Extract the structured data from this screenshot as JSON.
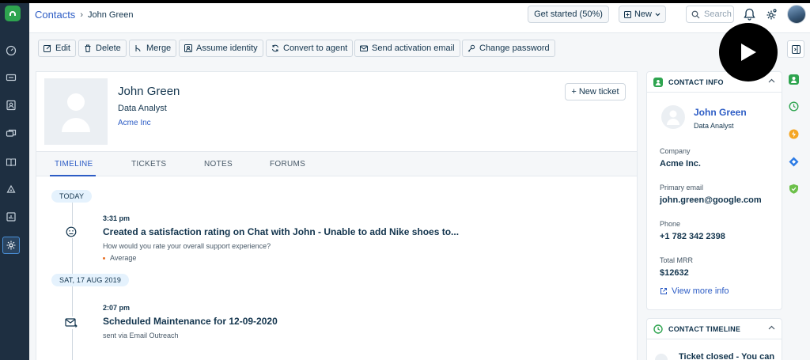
{
  "header": {
    "breadcrumb_root": "Contacts",
    "breadcrumb_sep": "›",
    "breadcrumb_current": "John Green",
    "get_started": "Get started (50%)",
    "new_label": "New",
    "search_placeholder": "Search"
  },
  "toolbar": {
    "edit": "Edit",
    "delete": "Delete",
    "merge": "Merge",
    "assume_identity": "Assume identity",
    "convert_to_agent": "Convert to agent",
    "send_activation_email": "Send activation email",
    "change_password": "Change password"
  },
  "contact": {
    "name": "John Green",
    "title": "Data Analyst",
    "company": "Acme Inc",
    "new_ticket": "New ticket",
    "new_ticket_plus": "+"
  },
  "tabs": [
    {
      "label": "TIMELINE",
      "active": true
    },
    {
      "label": "TICKETS",
      "active": false
    },
    {
      "label": "NOTES",
      "active": false
    },
    {
      "label": "FORUMS",
      "active": false
    }
  ],
  "timeline": {
    "groups": [
      {
        "day": "TODAY",
        "time": "3:31 pm",
        "title": "Created a satisfaction rating on Chat with John - Unable to add Nike shoes to...",
        "subtitle": "How would you rate your overall support experience?",
        "detail": "Average",
        "icon": "smiley-icon"
      },
      {
        "day": "SAT, 17 AUG 2019",
        "time": "2:07 pm",
        "title": "Scheduled Maintenance for 12-09-2020",
        "subtitle": "sent via Email Outreach",
        "icon": "email-out-icon"
      }
    ]
  },
  "contact_info": {
    "heading": "CONTACT INFO",
    "name": "John Green",
    "title": "Data Analyst",
    "company_label": "Company",
    "company_value": "Acme Inc.",
    "email_label": "Primary email",
    "email_value": "john.green@google.com",
    "phone_label": "Phone",
    "phone_value": "+1 782 342 2398",
    "mrr_label": "Total MRR",
    "mrr_value": "$12632",
    "view_more": "View more info"
  },
  "contact_timeline": {
    "heading": "CONTACT TIMELINE",
    "first_item": "Ticket closed - You can"
  },
  "colors": {
    "nav_bg": "#1e2f41",
    "link": "#2c5cc5",
    "brand_green": "#2ea44f",
    "accent_orange": "#e86f25"
  }
}
